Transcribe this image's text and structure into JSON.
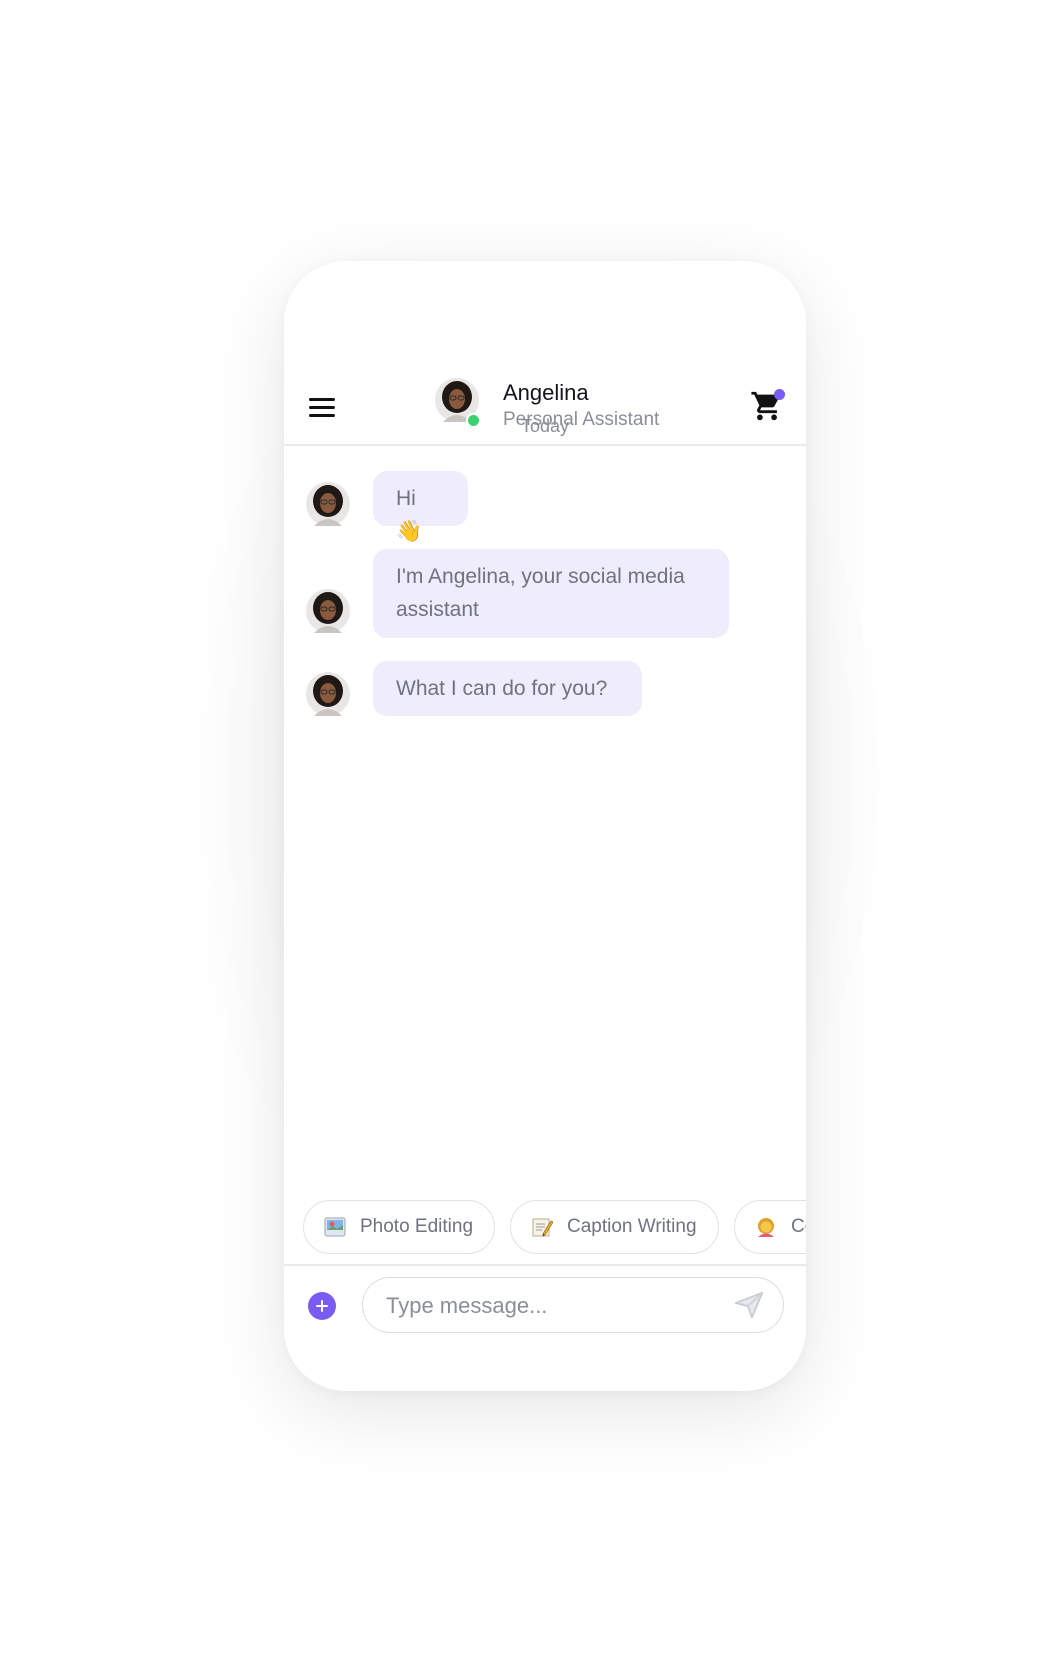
{
  "header": {
    "name": "Angelina",
    "role": "Personal Assistant",
    "status": "online",
    "menu_icon": "hamburger-menu-icon",
    "cart_icon": "shopping-cart-icon"
  },
  "chat": {
    "date_label": "Today",
    "messages": [
      {
        "text": "Hi 👋"
      },
      {
        "text": "I'm Angelina, your social media assistant"
      },
      {
        "text": "What I can do for you?"
      }
    ]
  },
  "quick_replies": [
    {
      "label": "Photo Editing",
      "icon": "picture-icon"
    },
    {
      "label": "Caption Writing",
      "icon": "memo-icon"
    },
    {
      "label": "Co",
      "icon": "person-icon"
    }
  ],
  "composer": {
    "placeholder": "Type message...",
    "add_icon": "plus-icon",
    "send_icon": "send-icon"
  },
  "colors": {
    "accent": "#7b5cf2",
    "bubble": "#efedfb",
    "online": "#3bd16f",
    "muted_text": "#8a8e99"
  }
}
